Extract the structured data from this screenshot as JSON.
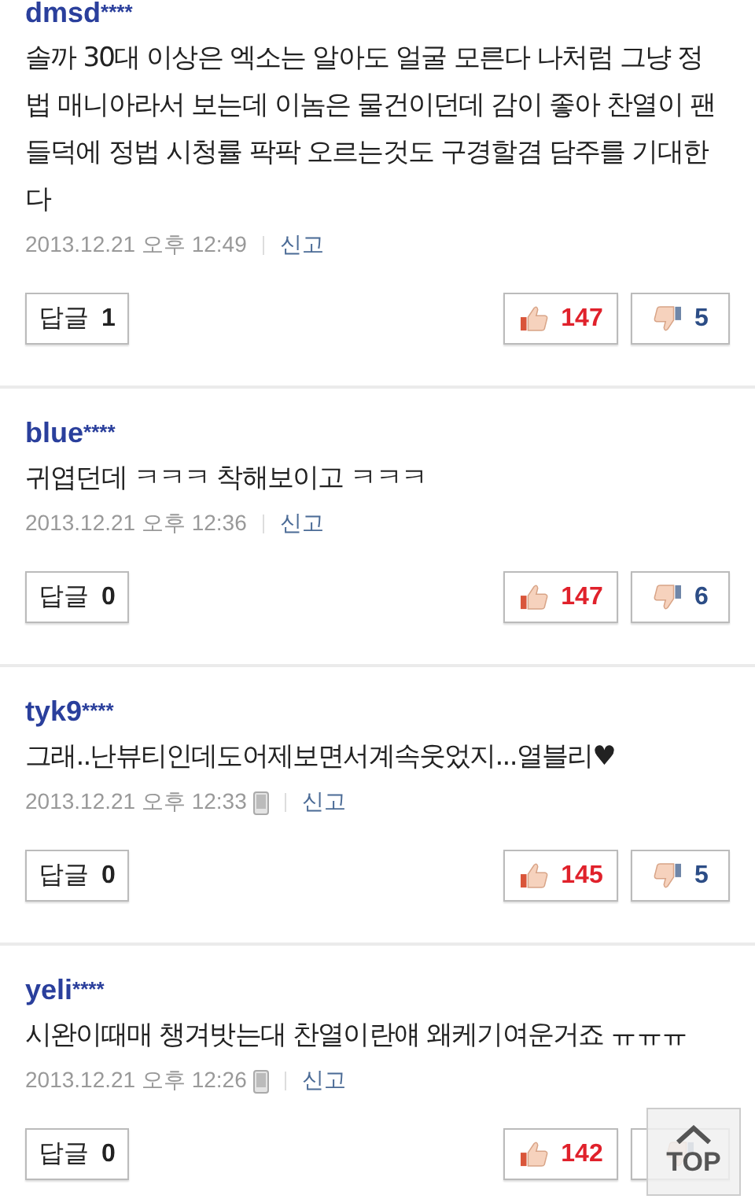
{
  "comments": [
    {
      "user": "dmsd",
      "mask": "****",
      "body": "솔까 30대 이상은 엑소는 알아도 얼굴 모른다 나처럼 그냥 정법 매니아라서 보는데 이놈은 물건이던데 감이 좋아 찬열이 팬들덕에 정법 시청률 팍팍 오르는것도 구경할겸 담주를 기대한다",
      "time": "2013.12.21 오후 12:49",
      "mobile": false,
      "report": "신고",
      "reply_label": "답글",
      "reply_count": "1",
      "likes": "147",
      "dislikes": "5"
    },
    {
      "user": "blue",
      "mask": "****",
      "body": "귀엽던데 ㅋㅋㅋ 착해보이고 ㅋㅋㅋ",
      "time": "2013.12.21 오후 12:36",
      "mobile": false,
      "report": "신고",
      "reply_label": "답글",
      "reply_count": "0",
      "likes": "147",
      "dislikes": "6"
    },
    {
      "user": "tyk9",
      "mask": "****",
      "body": "그래..난뷰티인데도어제보면서계속웃었지...열블리♥",
      "time": "2013.12.21 오후 12:33",
      "mobile": true,
      "report": "신고",
      "reply_label": "답글",
      "reply_count": "0",
      "likes": "145",
      "dislikes": "5"
    },
    {
      "user": "yeli",
      "mask": "****",
      "body": "시완이때매 챙겨밧는대 찬열이란얘 왜케기여운거죠 ㅠㅠㅠ",
      "time": "2013.12.21 오후 12:26",
      "mobile": true,
      "report": "신고",
      "reply_label": "답글",
      "reply_count": "0",
      "likes": "142"
    }
  ],
  "top_button": {
    "label": "TOP"
  }
}
